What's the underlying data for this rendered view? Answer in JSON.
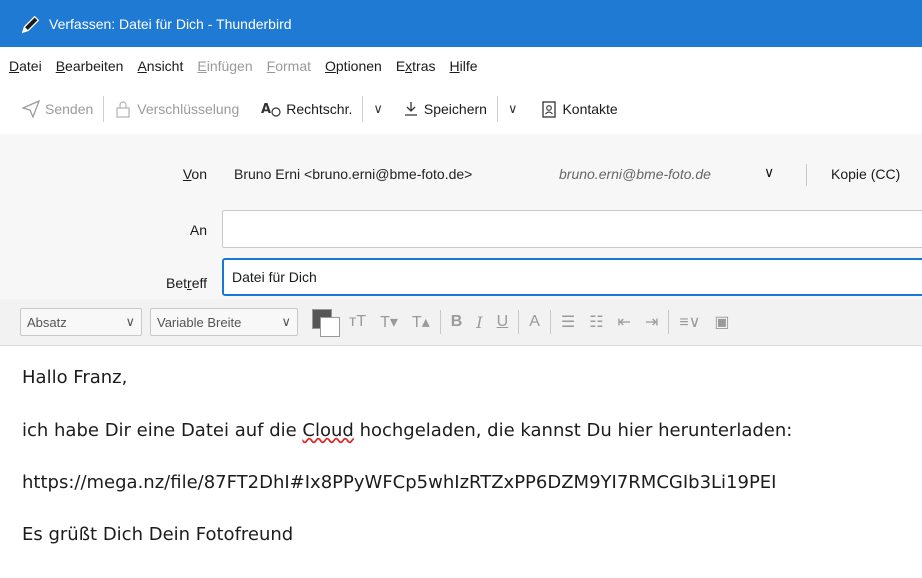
{
  "window": {
    "title": "Verfassen: Datei für Dich - Thunderbird"
  },
  "menu": {
    "items": [
      {
        "label": "Datei",
        "enabled": true
      },
      {
        "label": "Bearbeiten",
        "enabled": true
      },
      {
        "label": "Ansicht",
        "enabled": true
      },
      {
        "label": "Einfügen",
        "enabled": false
      },
      {
        "label": "Format",
        "enabled": false
      },
      {
        "label": "Optionen",
        "enabled": true
      },
      {
        "label": "Extras",
        "enabled": true
      },
      {
        "label": "Hilfe",
        "enabled": true
      }
    ]
  },
  "toolbar": {
    "send_label": "Senden",
    "encryption_label": "Verschlüsselung",
    "spellcheck_label": "Rechtschr.",
    "save_label": "Speichern",
    "contacts_label": "Kontakte"
  },
  "headers": {
    "from_label": "Von",
    "from_value": "Bruno Erni <bruno.erni@bme-foto.de>",
    "from_identity": "bruno.erni@bme-foto.de",
    "cc_label": "Kopie (CC)",
    "to_label": "An",
    "to_value": "",
    "subject_label": "Betreff",
    "subject_value": "Datei für Dich"
  },
  "format_toolbar": {
    "paragraph_format": "Absatz",
    "font": "Variable Breite",
    "text_color": "#555555"
  },
  "message": {
    "greeting": "Hallo Franz,",
    "line1_before": "ich habe Dir eine Datei auf die ",
    "line1_misspelled": "Cloud",
    "line1_after": " hochgeladen, die kannst Du hier herunterladen:",
    "link": "https://mega.nz/file/87FT2DhI#Ix8PPyWFCp5whIzRTZxPP6DZM9YI7RMCGIb3Li19PEI",
    "closing": "Es grüßt Dich Dein Fotofreund"
  },
  "colors": {
    "titlebar": "#1f7ad4",
    "focus_border": "#1779d6",
    "spellcheck_underline": "#d92b2b"
  }
}
